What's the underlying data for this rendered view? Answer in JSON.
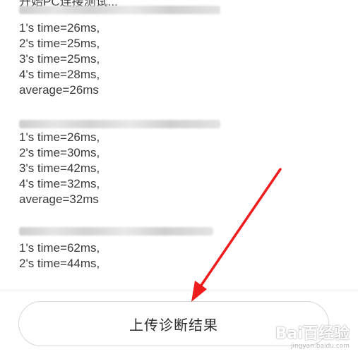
{
  "log": {
    "top_text": "开始PC连接测试...",
    "block1": [
      "1's time=26ms,",
      "2's time=25ms,",
      "3's time=25ms,",
      "4's time=28ms,",
      "average=26ms"
    ],
    "block2": [
      "1's time=26ms,",
      "2's time=30ms,",
      "3's time=42ms,",
      "4's time=32ms,",
      "average=32ms"
    ],
    "block3": [
      "1's time=62ms,",
      "2's time=44ms,"
    ]
  },
  "actions": {
    "upload_label": "上传诊断结果"
  },
  "watermark": {
    "brand": "Bai百经验",
    "url": "jingyan.baidu.com"
  },
  "colors": {
    "arrow": "#ee1c1c",
    "text": "#3a3a3a",
    "button_border": "#d7d7d7"
  }
}
